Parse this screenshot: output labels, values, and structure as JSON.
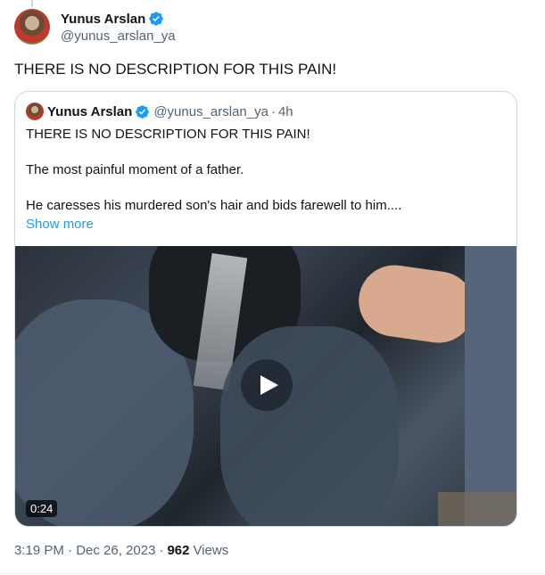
{
  "tweet": {
    "author": {
      "display_name": "Yunus Arslan",
      "handle": "@yunus_arslan_ya",
      "verified": true
    },
    "text": "THERE IS NO DESCRIPTION FOR THIS PAIN!",
    "timestamp": "3:19 PM · Dec 26, 2023",
    "views_count": "962",
    "views_label": "Views"
  },
  "quoted": {
    "author": {
      "display_name": "Yunus Arslan",
      "handle": "@yunus_arslan_ya",
      "separator": "·",
      "time": "4h"
    },
    "paragraphs": [
      "THERE IS NO DESCRIPTION FOR THIS PAIN!",
      "The most painful moment of a father.",
      "He caresses his murdered son's hair and bids farewell to him...."
    ],
    "show_more": "Show more",
    "video": {
      "duration": "0:24"
    }
  },
  "colors": {
    "accent": "#1d9bf0",
    "secondary_text": "#536471",
    "border": "#cfd9de"
  },
  "icons": {
    "verified": "verified-badge-icon",
    "play": "play-icon"
  }
}
